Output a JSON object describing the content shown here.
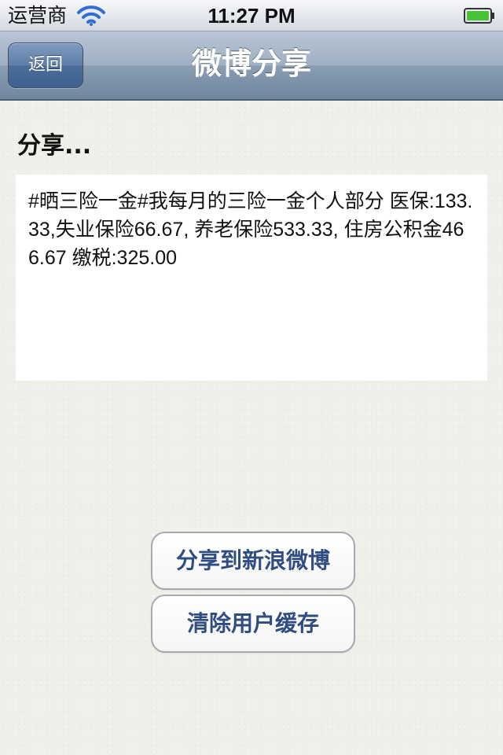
{
  "status_bar": {
    "carrier": "运营商",
    "time": "11:27 PM",
    "wifi_icon": "wifi-icon",
    "battery_icon": "battery-icon",
    "battery_level": 1.0,
    "battery_color": "#48c238"
  },
  "nav_bar": {
    "back_label": "返回",
    "title": "微博分享"
  },
  "content": {
    "share_label": "分享...",
    "share_text": "#晒三险一金#我每月的三险一金个人部分 医保:133.33,失业保险66.67, 养老保险533.33, 住房公积金466.67 缴税:325.00"
  },
  "buttons": {
    "share_weibo": "分享到新浪微博",
    "clear_cache": "清除用户缓存"
  },
  "colors": {
    "nav_bar": "#8a9db3",
    "back_button": "#4c6d98",
    "button_text": "#2f4d80",
    "background": "#f1efea"
  }
}
